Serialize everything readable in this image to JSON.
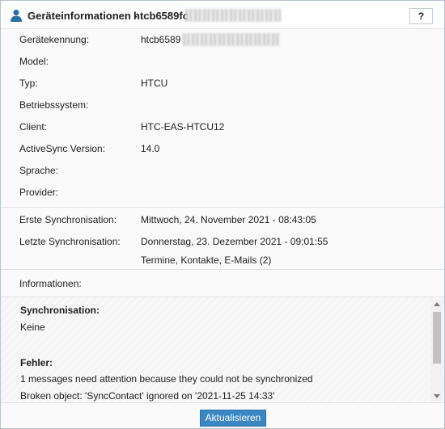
{
  "header": {
    "title": "Geräteinformationen -",
    "device_id_visible": "htcb6589fc",
    "help_label": "?",
    "icon": "user-icon"
  },
  "device": {
    "fields": [
      {
        "label": "Gerätekennung:",
        "value": "htcb6589"
      },
      {
        "label": "Model:",
        "value": ""
      },
      {
        "label": "Typ:",
        "value": "HTCU"
      },
      {
        "label": "Betriebssystem:",
        "value": ""
      },
      {
        "label": "Client:",
        "value": "HTC-EAS-HTCU12"
      },
      {
        "label": "ActiveSync Version:",
        "value": "14.0"
      },
      {
        "label": "Sprache:",
        "value": ""
      },
      {
        "label": "Provider:",
        "value": ""
      }
    ]
  },
  "sync": {
    "first_label": "Erste Synchronisation:",
    "first_value": "Mittwoch, 24. November 2021 - 08:43:05",
    "last_label": "Letzte Synchronisation:",
    "last_value": "Donnerstag, 23. Dezember 2021 - 09:01:55",
    "last_detail": "Termine, Kontakte, E-Mails (2)"
  },
  "info": {
    "label": "Informationen:",
    "lines": [
      {
        "text": "Synchronisation:",
        "bold": true
      },
      {
        "text": "Keine",
        "bold": false
      },
      {
        "text": "Fehler:",
        "bold": true
      },
      {
        "text": "1 messages need attention because they could not be synchronized",
        "bold": false
      },
      {
        "text": "Broken object: 'SyncContact' ignored on '2021-11-25 14:33'",
        "bold": false
      }
    ]
  },
  "footer": {
    "refresh_label": "Aktualisieren"
  },
  "colors": {
    "accent": "#3a87c4",
    "icon": "#2b6ea6"
  }
}
